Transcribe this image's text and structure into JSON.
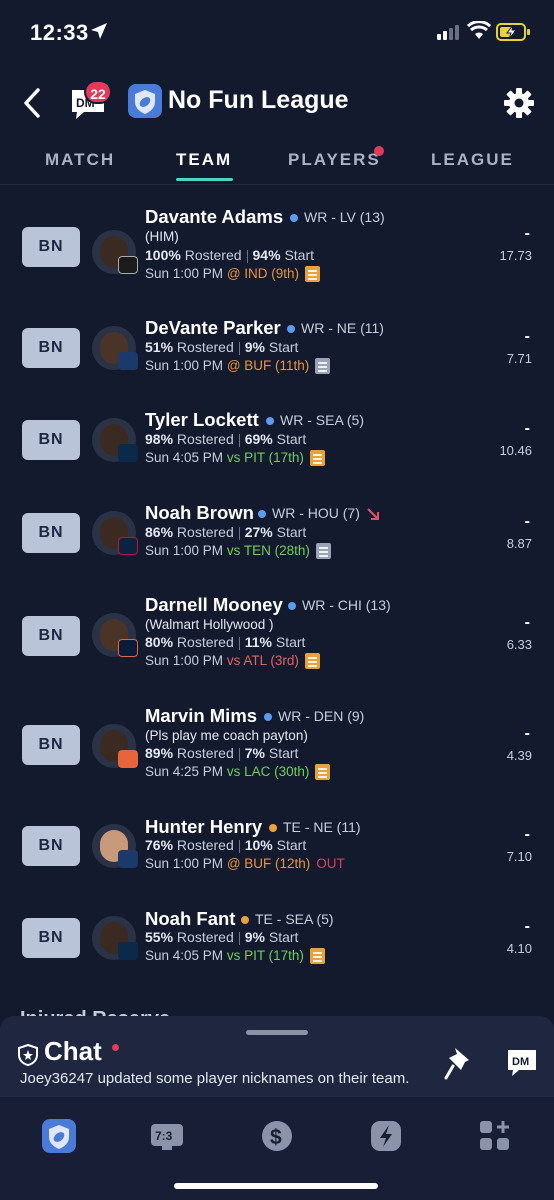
{
  "status_bar": {
    "time": "12:33"
  },
  "header": {
    "back_icon": "chevron-left-icon",
    "dm_badge_count": "22",
    "league_name": "No Fun League",
    "settings_icon": "gear-icon"
  },
  "tabs": [
    {
      "label": "MATCH",
      "active": false
    },
    {
      "label": "TEAM",
      "active": true
    },
    {
      "label": "PLAYERS",
      "active": false,
      "notification_dot": true
    },
    {
      "label": "LEAGUE",
      "active": false
    }
  ],
  "roster": [
    {
      "slot": "BN",
      "name": "Davante Adams",
      "pos_team": "WR - LV (13)",
      "pos_color": "#5b9cf0",
      "nickname": "(HIM)",
      "rostered": "100%",
      "rostered_label": "Rostered",
      "start": "94%",
      "start_label": "Start",
      "game_time": "Sun 1:00 PM",
      "opponent": "@ IND (9th)",
      "opp_color": "orange",
      "note": "orange",
      "proj_dash": "-",
      "proj": "17.73"
    },
    {
      "slot": "BN",
      "name": "DeVante Parker",
      "pos_team": "WR - NE (11)",
      "pos_color": "#5b9cf0",
      "nickname": "",
      "rostered": "51%",
      "rostered_label": "Rostered",
      "start": "9%",
      "start_label": "Start",
      "game_time": "Sun 1:00 PM",
      "opponent": "@ BUF (11th)",
      "opp_color": "orange",
      "note": "gray",
      "proj_dash": "-",
      "proj": "7.71"
    },
    {
      "slot": "BN",
      "name": "Tyler Lockett",
      "pos_team": "WR - SEA (5)",
      "pos_color": "#5b9cf0",
      "nickname": "",
      "rostered": "98%",
      "rostered_label": "Rostered",
      "start": "69%",
      "start_label": "Start",
      "game_time": "Sun 4:05 PM",
      "opponent": "vs PIT (17th)",
      "opp_color": "green",
      "note": "orange",
      "proj_dash": "-",
      "proj": "10.46"
    },
    {
      "slot": "BN",
      "name": "Noah Brown",
      "pos_team": "WR - HOU (7)",
      "pos_color": "#5b9cf0",
      "nickname": "",
      "trend": "trending-down-icon",
      "rostered": "86%",
      "rostered_label": "Rostered",
      "start": "27%",
      "start_label": "Start",
      "game_time": "Sun 1:00 PM",
      "opponent": "vs TEN (28th)",
      "opp_color": "green",
      "note": "gray",
      "proj_dash": "-",
      "proj": "8.87"
    },
    {
      "slot": "BN",
      "name": "Darnell Mooney",
      "pos_team": "WR - CHI (13)",
      "pos_color": "#5b9cf0",
      "nickname": "(Walmart Hollywood )",
      "rostered": "80%",
      "rostered_label": "Rostered",
      "start": "11%",
      "start_label": "Start",
      "game_time": "Sun 1:00 PM",
      "opponent": "vs ATL (3rd)",
      "opp_color": "red",
      "note": "orange",
      "proj_dash": "-",
      "proj": "6.33"
    },
    {
      "slot": "BN",
      "name": "Marvin Mims",
      "pos_team": "WR - DEN (9)",
      "pos_color": "#5b9cf0",
      "nickname": "(Pls play me coach payton)",
      "rostered": "89%",
      "rostered_label": "Rostered",
      "start": "7%",
      "start_label": "Start",
      "game_time": "Sun 4:25 PM",
      "opponent": "vs LAC (30th)",
      "opp_color": "green",
      "note": "orange",
      "proj_dash": "-",
      "proj": "4.39"
    },
    {
      "slot": "BN",
      "name": "Hunter Henry",
      "pos_team": "TE - NE (11)",
      "pos_color": "#e8a23a",
      "nickname": "",
      "rostered": "76%",
      "rostered_label": "Rostered",
      "start": "10%",
      "start_label": "Start",
      "game_time": "Sun 1:00 PM",
      "opponent": "@ BUF (12th)",
      "opp_color": "orange",
      "status": "OUT",
      "note": "",
      "proj_dash": "-",
      "proj": "7.10"
    },
    {
      "slot": "BN",
      "name": "Noah Fant",
      "pos_team": "TE - SEA (5)",
      "pos_color": "#e8a23a",
      "nickname": "",
      "rostered": "55%",
      "rostered_label": "Rostered",
      "start": "9%",
      "start_label": "Start",
      "game_time": "Sun 4:05 PM",
      "opponent": "vs PIT (17th)",
      "opp_color": "green",
      "note": "orange",
      "proj_dash": "-",
      "proj": "4.10"
    }
  ],
  "section_peek": "Injured Reserve",
  "chat": {
    "title": "Chat",
    "message": "Joey36247 updated some player nicknames on their team.",
    "pin_icon": "pin-icon",
    "dm_label": "DM"
  },
  "bottom_nav": [
    {
      "icon": "league-shield-icon",
      "active": true
    },
    {
      "icon": "scoreboard-icon",
      "label": "7:3"
    },
    {
      "icon": "dollar-icon"
    },
    {
      "icon": "lightning-icon"
    },
    {
      "icon": "apps-grid-icon"
    }
  ],
  "colors": {
    "background": "#131a2e",
    "accent_teal": "#4fd3c4",
    "badge_red": "#e23a5a",
    "wr_blue": "#5b9cf0",
    "te_orange": "#e8a23a"
  }
}
